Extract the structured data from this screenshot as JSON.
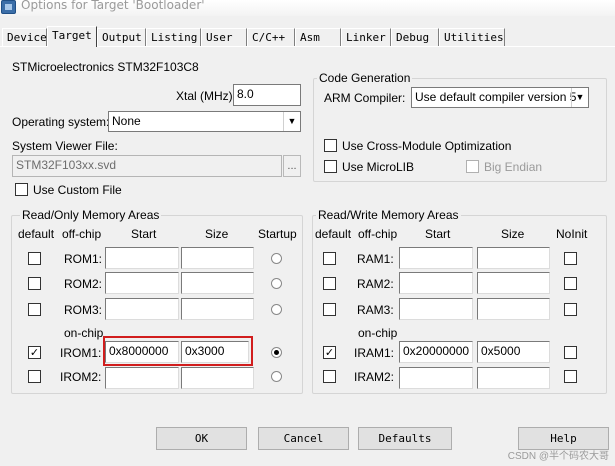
{
  "window": {
    "title": "Options for Target 'Bootloader'"
  },
  "tabs": [
    "Device",
    "Target",
    "Output",
    "Listing",
    "User",
    "C/C++",
    "Asm",
    "Linker",
    "Debug",
    "Utilities"
  ],
  "active_tab": "Target",
  "device": {
    "name": "STMicroelectronics STM32F103C8"
  },
  "xtal": {
    "label": "Xtal (MHz):",
    "value": "8.0"
  },
  "os": {
    "label": "Operating system:",
    "value": "None"
  },
  "viewer": {
    "label": "System Viewer File:",
    "value": "STM32F103xx.svd",
    "browse": "...",
    "custom_label": "Use Custom File",
    "custom_checked": false
  },
  "codegen": {
    "title": "Code Generation",
    "compiler_label": "ARM Compiler:",
    "compiler_value": "Use default compiler version 5",
    "cross_module": "Use Cross-Module Optimization",
    "microlib": "Use MicroLIB",
    "big_endian": "Big Endian"
  },
  "rom": {
    "title": "Read/Only Memory Areas",
    "headers": {
      "default": "default",
      "offchip": "off-chip",
      "start": "Start",
      "size": "Size",
      "startup": "Startup"
    },
    "onchip_label": "on-chip",
    "rows": [
      {
        "name": "ROM1:",
        "start": "",
        "size": "",
        "default": false,
        "startup": false
      },
      {
        "name": "ROM2:",
        "start": "",
        "size": "",
        "default": false,
        "startup": false
      },
      {
        "name": "ROM3:",
        "start": "",
        "size": "",
        "default": false,
        "startup": false
      },
      {
        "name": "IROM1:",
        "start": "0x8000000",
        "size": "0x3000",
        "default": true,
        "startup": true
      },
      {
        "name": "IROM2:",
        "start": "",
        "size": "",
        "default": false,
        "startup": false
      }
    ]
  },
  "ram": {
    "title": "Read/Write Memory Areas",
    "headers": {
      "default": "default",
      "offchip": "off-chip",
      "start": "Start",
      "size": "Size",
      "noinit": "NoInit"
    },
    "onchip_label": "on-chip",
    "rows": [
      {
        "name": "RAM1:",
        "start": "",
        "size": "",
        "default": false,
        "noinit": false
      },
      {
        "name": "RAM2:",
        "start": "",
        "size": "",
        "default": false,
        "noinit": false
      },
      {
        "name": "RAM3:",
        "start": "",
        "size": "",
        "default": false,
        "noinit": false
      },
      {
        "name": "IRAM1:",
        "start": "0x20000000",
        "size": "0x5000",
        "default": true,
        "noinit": false
      },
      {
        "name": "IRAM2:",
        "start": "",
        "size": "",
        "default": false,
        "noinit": false
      }
    ]
  },
  "buttons": {
    "ok": "OK",
    "cancel": "Cancel",
    "defaults": "Defaults",
    "help": "Help"
  },
  "watermark": "CSDN @半个码农大哥",
  "colors": {
    "highlight": "#d11d1d",
    "background": "#f0f0f0"
  }
}
